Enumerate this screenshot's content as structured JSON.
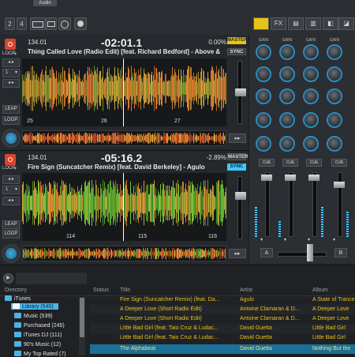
{
  "topbar": {
    "audio_label": "Audio",
    "buttons": [
      "2",
      "4",
      "",
      "",
      "",
      ""
    ]
  },
  "deck_a": {
    "letter": "A",
    "loop_label": "LOOP",
    "position": "134.01",
    "time": "-02:01.1",
    "pitch": "0.00%",
    "track": "Thing Called Love (Radio Edit) [feat. Richard Bedford] - Above &",
    "master_label": "MASTER",
    "sync_label": "SYNC",
    "beats": [
      "25",
      "26",
      "27"
    ],
    "loop_size": "1",
    "leap_label": "LEAP",
    "loop2_label": "LOOP"
  },
  "deck_b": {
    "letter": "B",
    "loop_label": "LOOP",
    "position": "134.01",
    "time": "-05:16.2",
    "pitch": "-2.89%",
    "track": "Fire Sign (Suncatcher Remix) [feat. David Berkeley] - Agulo",
    "master_label": "MASTER",
    "sync_label": "SYNC",
    "beats": [
      "114",
      "115",
      "116"
    ],
    "loop_size": "1",
    "leap_label": "LEAP",
    "loop2_label": "LOOP"
  },
  "mixer": {
    "gain_label": "GAIN",
    "cue_label": "CUE",
    "tabs": [
      "",
      "FX",
      "",
      "",
      "",
      ""
    ]
  },
  "browser": {
    "headers": {
      "directory": "Directory",
      "status": "Status",
      "title": "Title",
      "artist": "Artist",
      "album": "Album"
    },
    "tree": [
      {
        "label": "iTunes"
      },
      {
        "label": "Library (540)"
      },
      {
        "label": "Music (539)"
      },
      {
        "label": "Purchased (245)"
      },
      {
        "label": "iTunes DJ (111)"
      },
      {
        "label": "90's Music (12)"
      },
      {
        "label": "My Top Rated (7)"
      }
    ],
    "rows": [
      {
        "title": "Fire Sign (Suncatcher Remix) (feat. Da...",
        "artist": "Agulo",
        "album": "A State of Trance"
      },
      {
        "title": "A Deeper Love (Short Radio Edit)",
        "artist": "Antoine Clamaran & D...",
        "album": "A Deeper Love"
      },
      {
        "title": "A Deeper Love (Short Radio Edit)",
        "artist": "Antoine Clamaran & D...",
        "album": "A Deeper Love"
      },
      {
        "title": "Little Bad Girl (feat. Taio Cruz & Ludac...",
        "artist": "David Guetta",
        "album": "Little Bad Girl"
      },
      {
        "title": "Little Bad Girl (feat. Taio Cruz & Ludac...",
        "artist": "David Guetta",
        "album": "Little Bad Girl"
      },
      {
        "title": "The Alphabeat",
        "artist": "David Guetta",
        "album": "Nothing But the"
      }
    ]
  },
  "colors": {
    "accent": "#2a8cc0",
    "record": "#d9432c",
    "master": "#e8c21b",
    "sync": "#3ec9ff",
    "title_text": "#e8c21b"
  }
}
